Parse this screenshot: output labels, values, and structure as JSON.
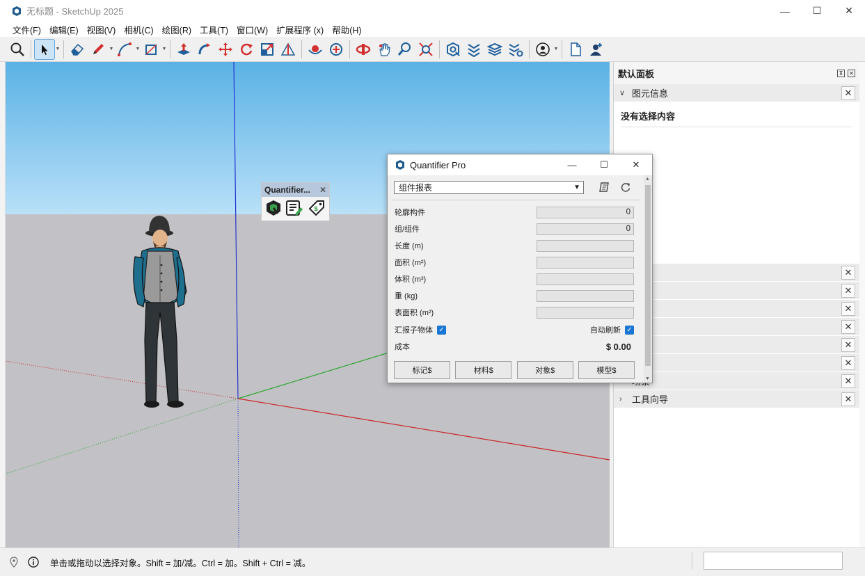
{
  "window": {
    "title": "无标题 - SketchUp 2025",
    "minimize": "—",
    "maximize": "☐",
    "close": "✕"
  },
  "menu": [
    "文件(F)",
    "编辑(E)",
    "视图(V)",
    "相机(C)",
    "绘图(R)",
    "工具(T)",
    "窗口(W)",
    "扩展程序 (x)",
    "帮助(H)"
  ],
  "toolbar_icons": [
    "search-icon",
    "select-arrow-icon",
    "eraser-icon",
    "pencil-icon",
    "arc-icon",
    "rectangle-icon",
    "push-pull-icon",
    "follow-me-icon",
    "move-icon",
    "rotate-icon",
    "scale-icon",
    "section-plane-icon",
    "orbit-icon",
    "pan-icon",
    "zoom-icon",
    "zoom-extents-icon",
    "warehouse-icon",
    "extension-warehouse-icon",
    "layout-icon",
    "extension-manager-icon",
    "account-icon",
    "new-file-icon",
    "add-user-icon"
  ],
  "floating_toolbar": {
    "title": "Quantifier...",
    "close": "✕"
  },
  "panel": {
    "title": "默认面板",
    "entity_info": {
      "label": "图元信息",
      "empty_text": "没有选择内容"
    },
    "scenes_label": "场景",
    "instructor_label": "工具向导",
    "close_glyph": "✕"
  },
  "dialog": {
    "title": "Quantifier Pro",
    "select_value": "组件报表",
    "fields": [
      {
        "label": "轮廓构件",
        "value": "0"
      },
      {
        "label": "组/组件",
        "value": "0"
      },
      {
        "label": "长度 (m)",
        "value": ""
      },
      {
        "label": "面积 (m²)",
        "value": ""
      },
      {
        "label": "体积 (m³)",
        "value": ""
      },
      {
        "label": "重 (kg)",
        "value": ""
      },
      {
        "label": "表面积 (m²)",
        "value": ""
      }
    ],
    "report_children_label": "汇报子物体",
    "auto_refresh_label": "自动刷新",
    "cost_label": "成本",
    "cost_value": "$ 0.00",
    "buttons": [
      "标记$",
      "材料$",
      "对象$",
      "模型$"
    ]
  },
  "status": {
    "text": "单击或拖动以选择对象。Shift = 加/减。Ctrl = 加。Shift + Ctrl = 减。"
  },
  "colors": {
    "sky_top": "#5bb2e6",
    "ground": "#c2c2c6",
    "axis_blue": "#2233cc",
    "axis_green": "#2aa52a",
    "axis_red": "#cc2222",
    "accent": "#1976d2"
  }
}
